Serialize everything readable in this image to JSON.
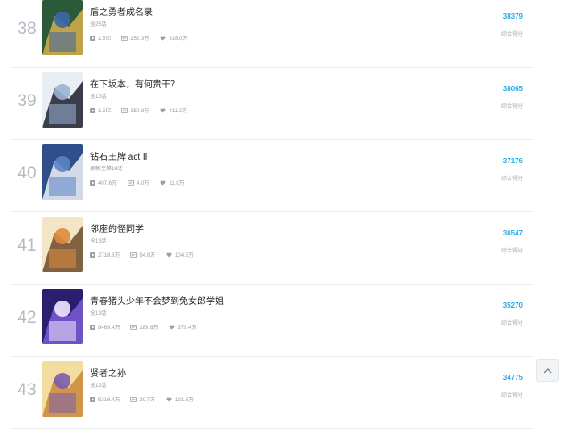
{
  "rankings": [
    {
      "rank": "38",
      "title": "盾之勇者成名录",
      "episodes": "全25话",
      "views": "1.5亿",
      "danmaku": "252.3万",
      "likes": "316.0万",
      "score": "38379",
      "score_label": "综合得分",
      "colors": [
        "#2b5a3a",
        "#d8b04a",
        "#3a66a8"
      ]
    },
    {
      "rank": "39",
      "title": "在下坂本，有何贵干？",
      "episodes": "全13话",
      "views": "1.5亿",
      "danmaku": "250.8万",
      "likes": "411.2万",
      "score": "38065",
      "score_label": "综合得分",
      "colors": [
        "#e9eef5",
        "#1c1f2b",
        "#9ab2d6"
      ]
    },
    {
      "rank": "40",
      "title": "钻石王牌 act II",
      "episodes": "更新至第18话",
      "views": "407.6万",
      "danmaku": "4.0万",
      "likes": "11.8万",
      "score": "37176",
      "score_label": "综合得分",
      "colors": [
        "#2f4f8a",
        "#eef2f8",
        "#5b83c4"
      ]
    },
    {
      "rank": "41",
      "title": "邻座的怪同学",
      "episodes": "全13话",
      "views": "2718.8万",
      "danmaku": "94.8万",
      "likes": "104.2万",
      "score": "36547",
      "score_label": "综合得分",
      "colors": [
        "#f3e6c6",
        "#6b4a2a",
        "#e08a3c"
      ]
    },
    {
      "rank": "42",
      "title": "青春猪头少年不会梦到兔女郎学姐",
      "episodes": "全13话",
      "views": "8469.4万",
      "danmaku": "189.6万",
      "likes": "379.4万",
      "score": "35270",
      "score_label": "综合得分",
      "colors": [
        "#2a1f6e",
        "#7b5cd6",
        "#f0e8ff"
      ]
    },
    {
      "rank": "43",
      "title": "贤者之孙",
      "episodes": "全12话",
      "views": "5316.4万",
      "danmaku": "20.7万",
      "likes": "191.3万",
      "score": "34775",
      "score_label": "综合得分",
      "colors": [
        "#f2dca0",
        "#c98a3c",
        "#7a5cb0"
      ]
    }
  ],
  "icons": {
    "views": "play-icon",
    "danmaku": "danmaku-icon",
    "likes": "heart-icon",
    "back_to_top": "chevron-up-icon"
  },
  "accent": "#23ade5"
}
